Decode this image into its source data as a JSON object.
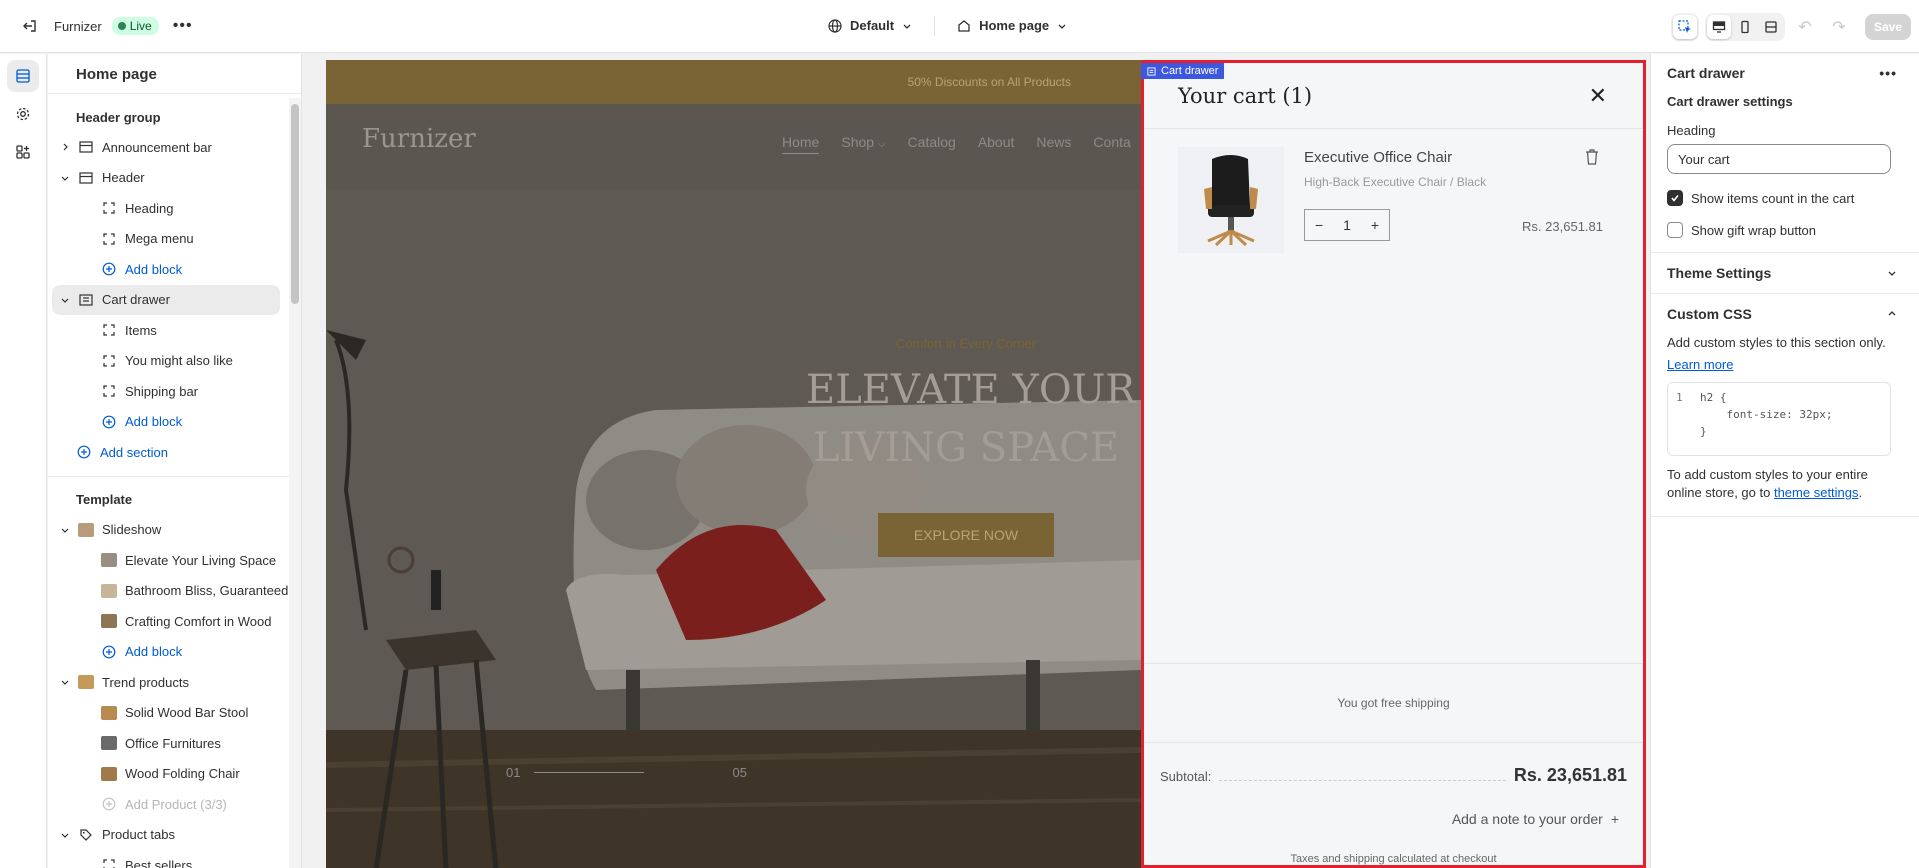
{
  "topbar": {
    "store_name": "Furnizer",
    "status": "Live",
    "theme": "Default",
    "page": "Home page",
    "save_label": "Save"
  },
  "sidebar": {
    "title": "Home page",
    "header_group_label": "Header group",
    "header_items": {
      "announcement_bar": "Announcement bar",
      "header": "Header",
      "heading": "Heading",
      "mega_menu": "Mega menu",
      "add_block": "Add block",
      "cart_drawer": "Cart drawer",
      "items": "Items",
      "you_might": "You might also like",
      "shipping_bar": "Shipping bar",
      "add_block_2": "Add block",
      "add_section": "Add section"
    },
    "template_label": "Template",
    "template_items": {
      "slideshow": "Slideshow",
      "slide1": "Elevate Your Living Space",
      "slide2": "Bathroom Bliss, Guaranteed",
      "slide3": "Crafting Comfort in Wood",
      "add_block": "Add block",
      "trend": "Trend products",
      "trend1": "Solid Wood Bar Stool",
      "trend2": "Office Furnitures",
      "trend3": "Wood Folding Chair",
      "add_product": "Add Product (3/3)",
      "product_tabs": "Product tabs",
      "best_sellers": "Best sellers"
    }
  },
  "store": {
    "announcement": "50% Discounts on All Products",
    "logo": "Furnizer",
    "nav": [
      "Home",
      "Shop",
      "Catalog",
      "About",
      "News",
      "Conta"
    ],
    "hero_eyebrow": "Comfort in Every Corner",
    "hero_title_1": "ELEVATE YOUR",
    "hero_title_2": "LIVING SPACE",
    "hero_button": "EXPLORE NOW",
    "slide_current": "01",
    "slide_total": "05"
  },
  "drawer": {
    "tag": "Cart drawer",
    "title": "Your cart (1)",
    "item_name": "Executive Office Chair",
    "item_variant": "High-Back Executive Chair / Black",
    "qty": "1",
    "price": "Rs. 23,651.81",
    "shipping_msg": "You got free shipping",
    "subtotal_label": "Subtotal:",
    "subtotal_value": "Rs. 23,651.81",
    "note": "Add a note to your order",
    "taxes": "Taxes and shipping calculated at checkout"
  },
  "settings": {
    "title": "Cart drawer",
    "section_title": "Cart drawer settings",
    "heading_label": "Heading",
    "heading_value": "Your cart",
    "show_count_label": "Show items count in the cart",
    "show_count_checked": true,
    "gift_wrap_label": "Show gift wrap button",
    "gift_wrap_checked": false,
    "theme_settings": "Theme Settings",
    "custom_css": "Custom CSS",
    "css_desc_1": "Add custom styles to ",
    "css_desc_bold": "this section only.",
    "learn_more": "Learn more",
    "code_line": "1",
    "code": "h2 {\n    font-size: 32px;\n}",
    "footer_text": "To add custom styles to your entire online store, go to ",
    "footer_link": "theme settings",
    "footer_end": "."
  }
}
